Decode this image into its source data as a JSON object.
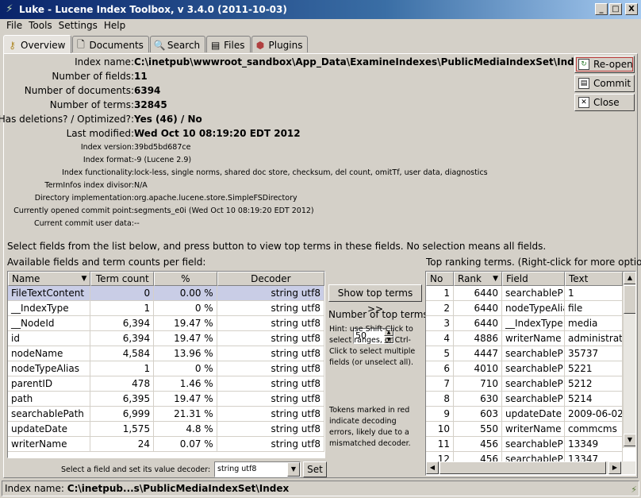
{
  "window": {
    "title": "Luke - Lucene Index Toolbox, v 3.4.0 (2011-10-03)",
    "app_icon": "luke-icon",
    "controls": [
      "_",
      "□",
      "X"
    ]
  },
  "menu": [
    "File",
    "Tools",
    "Settings",
    "Help"
  ],
  "tabs": [
    {
      "label": "Overview",
      "icon": "key-icon"
    },
    {
      "label": "Documents",
      "icon": "document-icon"
    },
    {
      "label": "Search",
      "icon": "search-icon"
    },
    {
      "label": "Files",
      "icon": "files-icon"
    },
    {
      "label": "Plugins",
      "icon": "plugins-icon"
    }
  ],
  "overview": {
    "main": [
      {
        "label": "Index name:",
        "value": "C:\\inetpub\\wwwroot_sandbox\\App_Data\\ExamineIndexes\\PublicMediaIndexSet\\Index"
      },
      {
        "label": "Number of fields:",
        "value": "11"
      },
      {
        "label": "Number of documents:",
        "value": "6394"
      },
      {
        "label": "Number of terms:",
        "value": "32845"
      },
      {
        "label": "Has deletions? / Optimized?:",
        "value": "Yes (46) / No"
      },
      {
        "label": "Last modified:",
        "value": "Wed Oct 10 08:19:20 EDT 2012"
      }
    ],
    "details": [
      {
        "label": "Index version:",
        "value": "39bd5bd687ce"
      },
      {
        "label": "Index format:",
        "value": "-9 (Lucene 2.9)"
      },
      {
        "label": "Index functionality:",
        "value": "lock-less, single norms, shared doc store, checksum, del count, omitTf, user data, diagnostics"
      },
      {
        "label": "TermInfos index divisor:",
        "value": "N/A"
      },
      {
        "label": "Directory implementation:",
        "value": "org.apache.lucene.store.SimpleFSDirectory"
      },
      {
        "label": "Currently opened commit point:",
        "value": "segments_e0i (Wed Oct 10 08:19:20 EDT 2012)"
      },
      {
        "label": "Current commit user data:",
        "value": "--"
      }
    ]
  },
  "actions": {
    "reopen": "Re-open",
    "commit": "Commit",
    "close": "Close"
  },
  "instruction": "Select fields from the list below, and press button to view top terms in these fields. No selection means all fields.",
  "fields_panel": {
    "title": "Available fields and term counts per field:",
    "columns": [
      "Name",
      "Term count",
      "%",
      "Decoder"
    ],
    "rows": [
      {
        "name": "FileTextContent",
        "count": "0",
        "pct": "0.00 %",
        "decoder": "string utf8",
        "selected": true
      },
      {
        "name": "__IndexType",
        "count": "1",
        "pct": "0 %",
        "decoder": "string utf8"
      },
      {
        "name": "__NodeId",
        "count": "6,394",
        "pct": "19.47 %",
        "decoder": "string utf8"
      },
      {
        "name": "id",
        "count": "6,394",
        "pct": "19.47 %",
        "decoder": "string utf8"
      },
      {
        "name": "nodeName",
        "count": "4,584",
        "pct": "13.96 %",
        "decoder": "string utf8"
      },
      {
        "name": "nodeTypeAlias",
        "count": "1",
        "pct": "0 %",
        "decoder": "string utf8"
      },
      {
        "name": "parentID",
        "count": "478",
        "pct": "1.46 %",
        "decoder": "string utf8"
      },
      {
        "name": "path",
        "count": "6,395",
        "pct": "19.47 %",
        "decoder": "string utf8"
      },
      {
        "name": "searchablePath",
        "count": "6,999",
        "pct": "21.31 %",
        "decoder": "string utf8"
      },
      {
        "name": "updateDate",
        "count": "1,575",
        "pct": "4.8 %",
        "decoder": "string utf8"
      },
      {
        "name": "writerName",
        "count": "24",
        "pct": "0.07 %",
        "decoder": "string utf8"
      }
    ],
    "decoder_label": "Select a field and set its value decoder:",
    "decoder_value": "string utf8",
    "set_label": "Set"
  },
  "middle": {
    "show_button": "Show top terms >>",
    "num_label": "Number of top terms:",
    "num_value": "50",
    "hint": "Hint: use Shift-Click to select ranges, or Ctrl-Click to select multiple fields (or unselect all).",
    "tokens_note": "Tokens marked in red indicate decoding errors, likely due to a mismatched decoder."
  },
  "terms_panel": {
    "title": "Top ranking terms. (Right-click for more options)",
    "columns": [
      "No",
      "Rank",
      "Field",
      "Text"
    ],
    "rows": [
      {
        "no": "1",
        "rank": "6440",
        "field": "searchableP:",
        "text": "1"
      },
      {
        "no": "2",
        "rank": "6440",
        "field": "nodeTypeAlia",
        "text": "file"
      },
      {
        "no": "3",
        "rank": "6440",
        "field": "__IndexType",
        "text": "media"
      },
      {
        "no": "4",
        "rank": "4886",
        "field": "writerName",
        "text": "administrat"
      },
      {
        "no": "5",
        "rank": "4447",
        "field": "searchableP:",
        "text": "35737"
      },
      {
        "no": "6",
        "rank": "4010",
        "field": "searchableP:",
        "text": "5221"
      },
      {
        "no": "7",
        "rank": "710",
        "field": "searchableP:",
        "text": "5212"
      },
      {
        "no": "8",
        "rank": "630",
        "field": "searchableP:",
        "text": "5214"
      },
      {
        "no": "9",
        "rank": "603",
        "field": "updateDate",
        "text": "2009-06-02"
      },
      {
        "no": "10",
        "rank": "550",
        "field": "writerName",
        "text": "commcms"
      },
      {
        "no": "11",
        "rank": "456",
        "field": "searchableP:",
        "text": "13349"
      },
      {
        "no": "12",
        "rank": "456",
        "field": "searchableP:",
        "text": "13347"
      }
    ]
  },
  "status": {
    "label": "Index name:",
    "value": "C:\\inetpub...s\\PublicMediaIndexSet\\Index"
  }
}
